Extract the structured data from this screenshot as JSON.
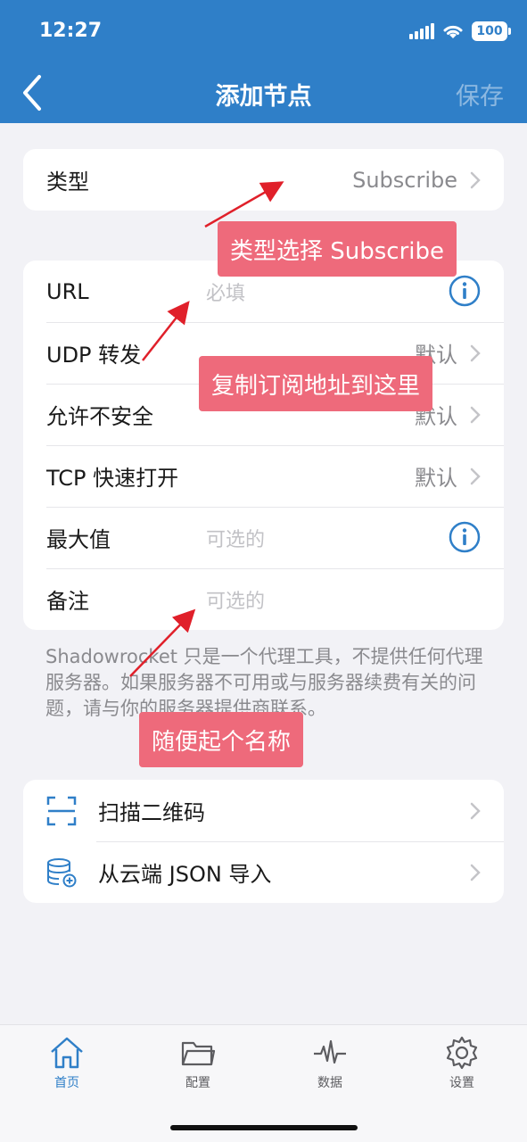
{
  "status": {
    "time": "12:27",
    "battery": "100"
  },
  "nav": {
    "title": "添加节点",
    "save": "保存"
  },
  "type_row": {
    "label": "类型",
    "value": "Subscribe"
  },
  "form": {
    "url": {
      "label": "URL",
      "placeholder": "必填"
    },
    "udp": {
      "label": "UDP 转发",
      "value": "默认"
    },
    "insecure": {
      "label": "允许不安全",
      "value": "默认"
    },
    "tfo": {
      "label": "TCP 快速打开",
      "value": "默认"
    },
    "max": {
      "label": "最大值",
      "placeholder": "可选的"
    },
    "remark": {
      "label": "备注",
      "placeholder": "可选的"
    }
  },
  "footnote": "Shadowrocket 只是一个代理工具，不提供任何代理服务器。如果服务器不可用或与服务器续费有关的问题，请与你的服务器提供商联系。",
  "actions": {
    "scan": "扫描二维码",
    "json": "从云端 JSON 导入"
  },
  "annotations": {
    "type": "类型选择 Subscribe",
    "url": "复制订阅地址到这里",
    "remark": "随便起个名称"
  },
  "tabs": [
    {
      "label": "首页",
      "icon": "home-icon",
      "active": true
    },
    {
      "label": "配置",
      "icon": "folder-icon"
    },
    {
      "label": "数据",
      "icon": "pulse-icon"
    },
    {
      "label": "设置",
      "icon": "gear-icon"
    }
  ],
  "colors": {
    "accent": "#2f7fc8",
    "annotation": "#ee6a7b",
    "background": "#f2f2f6"
  }
}
